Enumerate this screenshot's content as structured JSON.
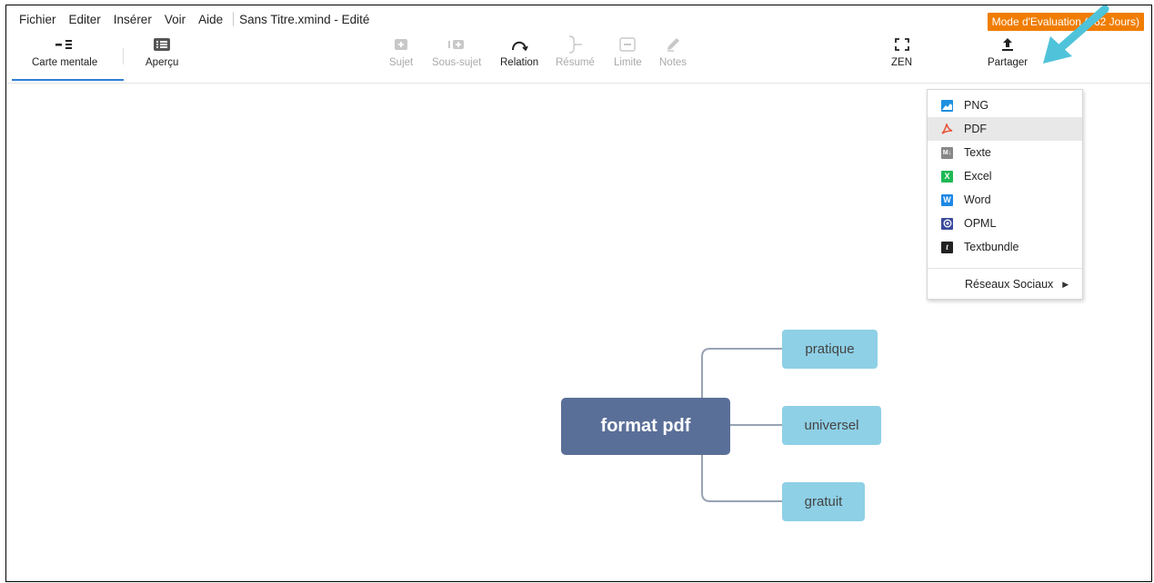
{
  "menubar": {
    "items": [
      "Fichier",
      "Editer",
      "Insérer",
      "Voir",
      "Aide"
    ],
    "doc_title": "Sans Titre.xmind - Edité",
    "eval_badge": "Mode d'Evaluation (362 Jours)"
  },
  "toolbar": {
    "mind_map": {
      "label": "Carte mentale",
      "icon": "mindmap-icon"
    },
    "outline": {
      "label": "Aperçu",
      "icon": "outline-list-icon"
    },
    "topic": {
      "label": "Sujet",
      "icon": "topic-icon"
    },
    "subtopic": {
      "label": "Sous-sujet",
      "icon": "subtopic-icon"
    },
    "relation": {
      "label": "Relation",
      "icon": "relation-curve-icon"
    },
    "summary": {
      "label": "Résumé",
      "icon": "summary-brace-icon"
    },
    "boundary": {
      "label": "Limite",
      "icon": "boundary-icon"
    },
    "notes": {
      "label": "Notes",
      "icon": "notes-pencil-icon"
    },
    "zen": {
      "label": "ZEN",
      "icon": "zen-fullscreen-icon"
    },
    "share": {
      "label": "Partager",
      "icon": "share-upload-icon"
    }
  },
  "mindmap": {
    "root": "format pdf",
    "children": [
      "pratique",
      "universel",
      "gratuit"
    ]
  },
  "share_menu": {
    "items": [
      {
        "label": "PNG",
        "icon": "png-image-icon",
        "color": "#1e90e0"
      },
      {
        "label": "PDF",
        "icon": "pdf-icon",
        "color": "#e8543a"
      },
      {
        "label": "Texte",
        "icon": "markdown-text-icon",
        "color": "#888888"
      },
      {
        "label": "Excel",
        "icon": "excel-icon",
        "color": "#1db954"
      },
      {
        "label": "Word",
        "icon": "word-icon",
        "color": "#1e88e5"
      },
      {
        "label": "OPML",
        "icon": "opml-icon",
        "color": "#3b4a9c"
      },
      {
        "label": "Textbundle",
        "icon": "textbundle-icon",
        "color": "#222222"
      }
    ],
    "highlighted_index": 1,
    "social": "Réseaux Sociaux"
  },
  "colors": {
    "accent": "#2f7fd6",
    "root_node": "#5a6f98",
    "sub_node": "#8ed0e6",
    "badge": "#f07d00",
    "annotation_arrow": "#4fc3d9"
  }
}
